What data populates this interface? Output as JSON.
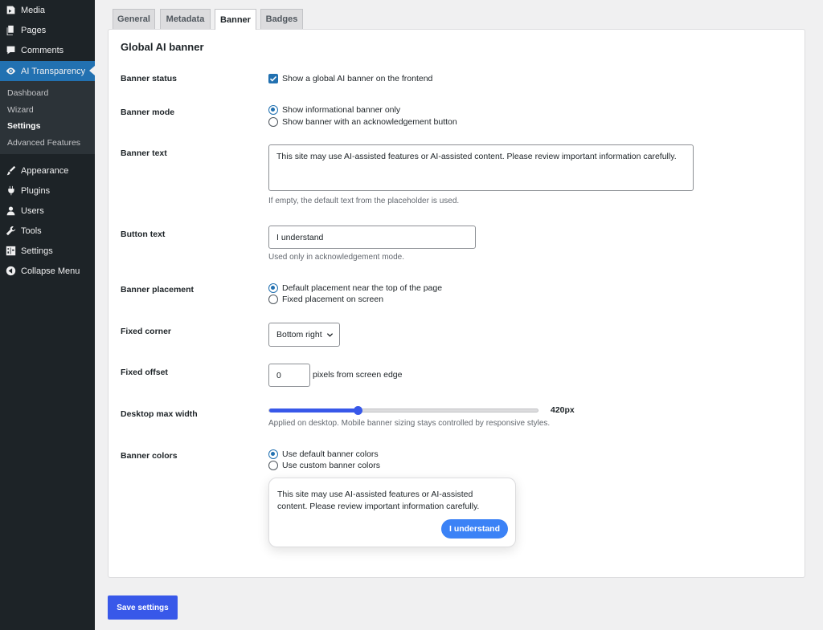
{
  "sidebar": {
    "items": [
      {
        "label": "Media",
        "icon": "media-icon"
      },
      {
        "label": "Pages",
        "icon": "pages-icon"
      },
      {
        "label": "Comments",
        "icon": "comments-icon"
      },
      {
        "label": "AI Transparency",
        "icon": "eye-icon"
      },
      {
        "label": "Appearance",
        "icon": "brush-icon"
      },
      {
        "label": "Plugins",
        "icon": "plugin-icon"
      },
      {
        "label": "Users",
        "icon": "user-icon"
      },
      {
        "label": "Tools",
        "icon": "wrench-icon"
      },
      {
        "label": "Settings",
        "icon": "settings-icon"
      },
      {
        "label": "Collapse Menu",
        "icon": "collapse-icon"
      }
    ],
    "submenu": [
      "Dashboard",
      "Wizard",
      "Settings",
      "Advanced Features"
    ],
    "current_submenu": "Settings"
  },
  "tabs": [
    {
      "label": "General"
    },
    {
      "label": "Metadata"
    },
    {
      "label": "Banner",
      "active": true
    },
    {
      "label": "Badges"
    }
  ],
  "panel": {
    "title": "Global AI banner",
    "banner_status": {
      "label": "Banner status",
      "checkbox_label": "Show a global AI banner on the frontend",
      "checked": true
    },
    "banner_mode": {
      "label": "Banner mode",
      "options": [
        "Show informational banner only",
        "Show banner with an acknowledgement button"
      ],
      "selected": 0
    },
    "banner_text": {
      "label": "Banner text",
      "value": "This site may use AI-assisted features or AI-assisted content. Please review important information carefully.",
      "help": "If empty, the default text from the placeholder is used."
    },
    "button_text": {
      "label": "Button text",
      "value": "I understand",
      "help": "Used only in acknowledgement mode."
    },
    "banner_placement": {
      "label": "Banner placement",
      "options": [
        "Default placement near the top of the page",
        "Fixed placement on screen"
      ],
      "selected": 0
    },
    "fixed_corner": {
      "label": "Fixed corner",
      "value": "Bottom right"
    },
    "fixed_offset": {
      "label": "Fixed offset",
      "value": "0",
      "suffix": "pixels from screen edge"
    },
    "max_width": {
      "label": "Desktop max width",
      "value_text": "420px",
      "fraction": 0.33,
      "help": "Applied on desktop. Mobile banner sizing stays controlled by responsive styles."
    },
    "banner_colors": {
      "label": "Banner colors",
      "options": [
        "Use default banner colors",
        "Use custom banner colors"
      ],
      "selected": 0
    },
    "preview": {
      "text": "This site may use AI-assisted features or AI-assisted content. Please review important information carefully.",
      "button": "I understand"
    }
  },
  "save_label": "Save settings",
  "colors": {
    "accent": "#3858e9",
    "sidebar": "#1d2327",
    "active_menu": "#2271b1",
    "preview_button": "#3b82f6"
  }
}
